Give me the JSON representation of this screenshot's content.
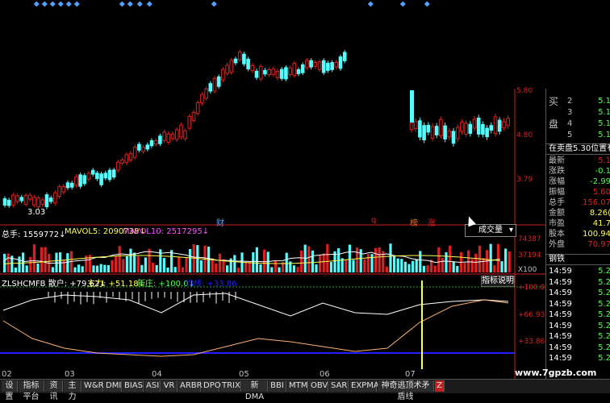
{
  "price_panel": {
    "low_label": "3.03",
    "axis": [
      "5.80",
      "4.80",
      "3.79"
    ],
    "markers": [
      "财",
      "q",
      "榜",
      "涨"
    ],
    "dropdown_label": "成交量"
  },
  "volume_panel": {
    "indicators": [
      "总手: 1559772↓",
      "MAVOL5: 2090738↓",
      "MAVOL10: 2517295↓"
    ],
    "axis": [
      "74387",
      "37194",
      "X100"
    ]
  },
  "indicator_panel": {
    "labels": [
      "ZLSHCMFB 散户: +79.62↓",
      "主力: +51.18↓",
      "新庄: +100.0↓",
      "均线: +33.86"
    ],
    "help_button": "指标说明",
    "axis": [
      "+100.0",
      "+66.93",
      "+33.86"
    ]
  },
  "dates": [
    "02",
    "03",
    "04",
    "05",
    "06",
    "07"
  ],
  "sidebar": {
    "header": "在卖盘5.30位置有",
    "order_book": [
      {
        "label": "买",
        "num": "2",
        "val": "5.1"
      },
      {
        "label": "",
        "num": "3",
        "val": "5.1"
      },
      {
        "label": "盘",
        "num": "4",
        "val": "5.1"
      },
      {
        "label": "",
        "num": "5",
        "val": "5.1"
      }
    ],
    "quotes": [
      {
        "label": "最新",
        "val": "5.1"
      },
      {
        "label": "涨跌",
        "val": "-0.1"
      },
      {
        "label": "涨幅",
        "val": "-2.99"
      },
      {
        "label": "振幅",
        "val": "5.60"
      },
      {
        "label": "总手",
        "val": "156.07"
      },
      {
        "label": "金额",
        "val": "8.26("
      },
      {
        "label": "市盈",
        "val": "41.7"
      },
      {
        "label": "股本",
        "val": "100.94"
      },
      {
        "label": "外盘",
        "val": "70.97"
      }
    ],
    "industry": "钢铁",
    "ticks": [
      {
        "time": "14:59",
        "val": "5.2"
      },
      {
        "time": "14:59",
        "val": "5.2"
      },
      {
        "time": "14:59",
        "val": "5.2"
      },
      {
        "time": "14:59",
        "val": "5.2"
      },
      {
        "time": "14:59",
        "val": "5.2"
      },
      {
        "time": "14:59",
        "val": "5.2"
      },
      {
        "time": "14:59",
        "val": "5.2"
      },
      {
        "time": "14:59",
        "val": "5.2"
      },
      {
        "time": "14:59",
        "val": "5.2"
      }
    ]
  },
  "tabs": [
    "设置",
    "指标平台",
    "资讯",
    "主力",
    "W&R",
    "DMI",
    "BIAS",
    "ASI",
    "VR",
    "ARBR",
    "DPO",
    "TRIX",
    "新DMA",
    "BBI",
    "MTM",
    "OBV",
    "SAR",
    "EXPMA",
    "神奇逃顶术矛盾线",
    "Z"
  ],
  "watermark": "www.7gpzb.com",
  "colors": {
    "up": "#e02020",
    "down": "#54ffff",
    "white": "#ffffff",
    "yellow": "#ffff54",
    "blue": "#2020ff"
  }
}
